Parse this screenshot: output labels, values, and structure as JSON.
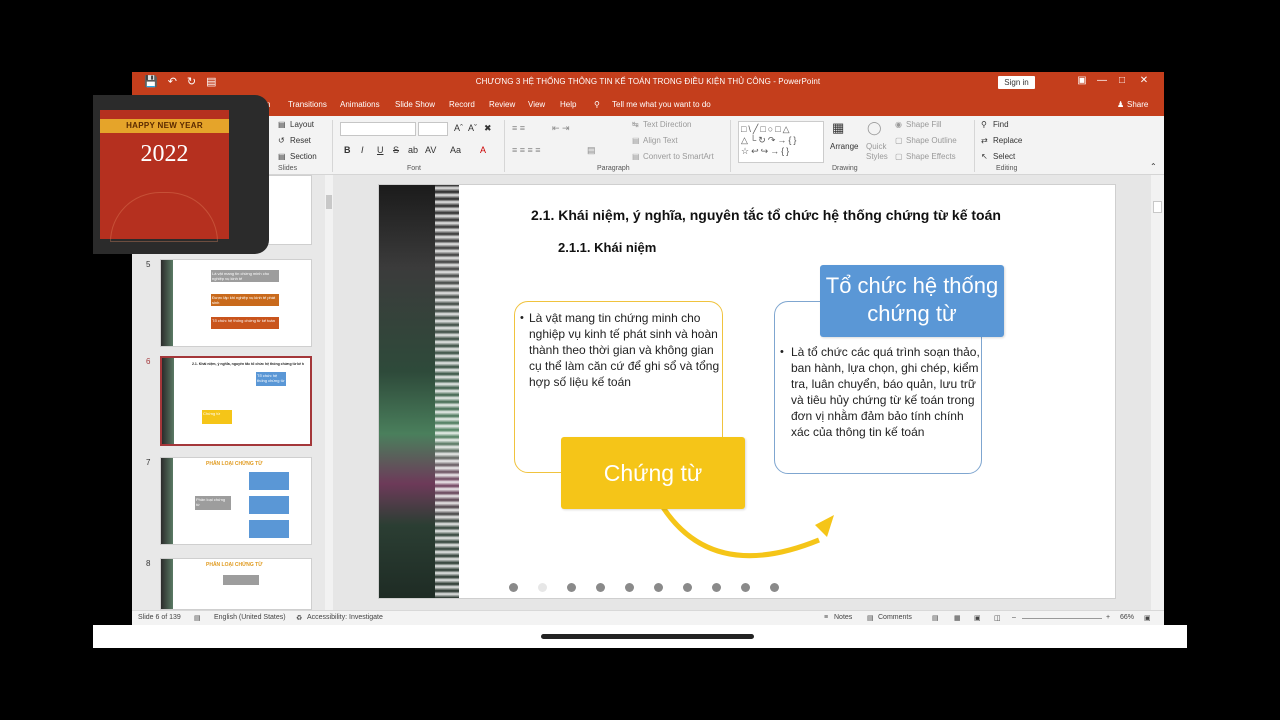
{
  "window": {
    "title": "CHƯƠNG 3 HỆ THỐNG THÔNG TIN KẾ TOÁN TRONG ĐIỀU KIỆN THỦ CÔNG  -  PowerPoint",
    "sign_in": "Sign in",
    "qat_icons": [
      "save-icon",
      "undo-icon",
      "redo-icon",
      "start-slideshow-icon"
    ],
    "controls": [
      "minimize-icon",
      "restore-icon",
      "close-icon"
    ]
  },
  "tabs": {
    "items": [
      "Transitions",
      "Animations",
      "Slide Show",
      "Record",
      "Review",
      "View",
      "Help"
    ],
    "partial": "n",
    "tell_me": "Tell me what you want to do",
    "share": "Share"
  },
  "ribbon": {
    "slides": {
      "layout": "Layout",
      "reset": "Reset",
      "section": "Section",
      "label": "Slides"
    },
    "font": {
      "label": "Font",
      "bold": "B",
      "italic": "I",
      "underline": "U",
      "strike": "S",
      "shadow": "ab",
      "spacing": "AV",
      "case": "Aa",
      "color": "A"
    },
    "paragraph": {
      "label": "Paragraph",
      "text_direction": "Text Direction",
      "align_text": "Align Text",
      "smartart": "Convert to SmartArt"
    },
    "drawing": {
      "label": "Drawing",
      "arrange": "Arrange",
      "quick_styles": "Quick\nStyles",
      "shape_fill": "Shape Fill",
      "shape_outline": "Shape Outline",
      "shape_effects": "Shape Effects"
    },
    "editing": {
      "label": "Editing",
      "find": "Find",
      "replace": "Replace",
      "select": "Select"
    }
  },
  "thumbs": [
    {
      "num": "5",
      "lines": [
        "Là vật mang tin chứng minh cho nghiệp vụ kinh tế",
        "Được lập khi nghiệp vụ kinh tế phát sinh",
        "Tổ chức hệ thống chứng từ kế toán"
      ]
    },
    {
      "num": "6",
      "title": "2.1. Khái niệm, ý nghĩa, nguyên tắc tổ chức hệ thống chứng từ kế toán",
      "box": "Tổ chức hệ thống chứng từ",
      "yel": "Chứng từ"
    },
    {
      "num": "7",
      "title": "PHÂN LOẠI CHỨNG TỪ",
      "center": "Phân loại chứng từ"
    },
    {
      "num": "8",
      "title": "PHÂN LOẠI CHỨNG TỪ"
    }
  ],
  "slide": {
    "heading": "2.1. Khái niệm, ý nghĩa, nguyên tắc tổ chức hệ thống chứng từ kế toán",
    "subheading": "2.1.1. Khái niệm",
    "left_bullet": "Là vật mang tin chứng minh cho nghiệp vụ kinh tế phát sinh và hoàn thành theo thời gian và không gian cụ thể làm căn cứ để ghi sổ và tổng hợp số liệu kế toán",
    "yellow_label": "Chứng từ",
    "blue_label": "Tổ chức hệ thống chứng từ",
    "right_bullet": "Là tổ chức các quá trình soạn thảo, ban hành, lựa chọn, ghi chép, kiểm tra, luân chuyển, báo quản, lưu trữ và tiêu hủy chứng từ kế toán trong đơn vị nhằm đảm bảo tính chính xác của thông tin kế toán",
    "dots_total": 10,
    "dots_active_index": 1,
    "colors": {
      "yellow": "#f5c518",
      "blue": "#5a97d6",
      "left_border": "#f0c33e",
      "right_border": "#7fa6d0"
    }
  },
  "status": {
    "slide_of": "Slide 6 of 139",
    "language": "English (United States)",
    "accessibility": "Accessibility: Investigate",
    "notes": "Notes",
    "comments": "Comments",
    "zoom": "66%"
  },
  "overlay": {
    "band": "HAPPY NEW YEAR",
    "year": "2022"
  }
}
